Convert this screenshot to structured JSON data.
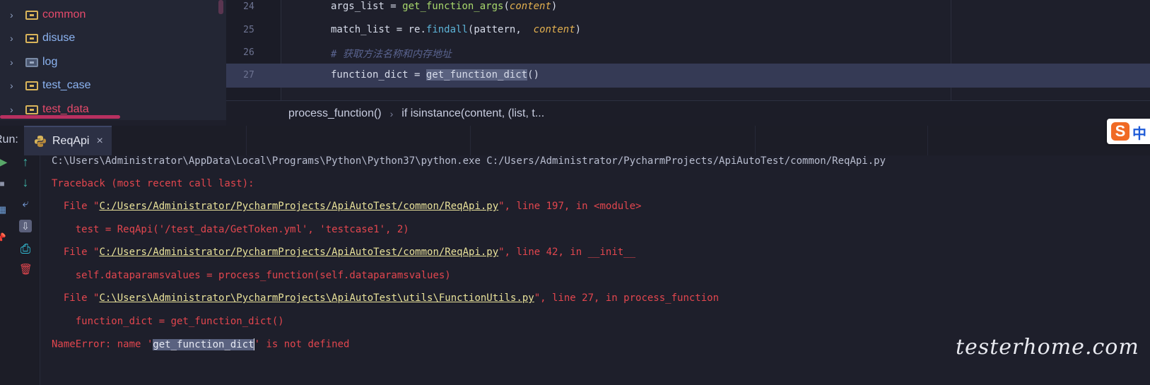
{
  "project_tree": {
    "items": [
      {
        "label": "common",
        "color": "#e64a6b",
        "folder": "folder-icon"
      },
      {
        "label": "disuse",
        "color": "#8cb4f2",
        "folder": "folder-icon"
      },
      {
        "label": "log",
        "color": "#8cb4f2",
        "folder": "log-folder-icon"
      },
      {
        "label": "test_case",
        "color": "#8cb4f2",
        "folder": "folder-icon"
      },
      {
        "label": "test_data",
        "color": "#e64a6b",
        "folder": "folder-icon"
      }
    ]
  },
  "editor": {
    "lines": [
      {
        "number": "24",
        "text_a": "args_list",
        "op": " = ",
        "fn": "get_function_args",
        "paren_open": "(",
        "param": "content",
        "paren_close": ")"
      },
      {
        "number": "25",
        "text_a": "match_list",
        "op": " = ",
        "mod": "re.",
        "fn": "findall",
        "paren_open": "(",
        "arg1": "pattern,  ",
        "param": "content",
        "paren_close": ")"
      },
      {
        "number": "26",
        "comment": "# 获取方法名称和内存地址"
      },
      {
        "number": "27",
        "text_a": "function_dict",
        "op": " = ",
        "fn_sel": "get_function_dict",
        "call": "()"
      }
    ]
  },
  "breadcrumb": {
    "item1": "process_function()",
    "separator": "›",
    "item2": "if isinstance(content, (list, t..."
  },
  "run_window": {
    "title": "Run:",
    "tab_label": "ReqApi",
    "tab_icon": "python-icon",
    "close_glyph": "×"
  },
  "ime": {
    "logo": "S",
    "lang": "中"
  },
  "toolbar": {
    "rerun": "▶",
    "stop": "■",
    "layout": "▦",
    "pin": "📌",
    "up": "↑",
    "down": "↓",
    "wrap": "⤶",
    "scroll_end": "⇩",
    "print": "⎙",
    "trash": "🗑"
  },
  "console": {
    "command": "C:\\Users\\Administrator\\AppData\\Local\\Programs\\Python\\Python37\\python.exe C:/Users/Administrator/PycharmProjects/ApiAutoTest/common/ReqApi.py",
    "traceback_header": "Traceback (most recent call last):",
    "frames": [
      {
        "prefix": "  File \"",
        "path": "C:/Users/Administrator/PycharmProjects/ApiAutoTest/common/ReqApi.py",
        "suffix": "\", line 197, in <module>",
        "code": "    test = ReqApi('/test_data/GetToken.yml', 'testcase1', 2)"
      },
      {
        "prefix": "  File \"",
        "path": "C:/Users/Administrator/PycharmProjects/ApiAutoTest/common/ReqApi.py",
        "suffix": "\", line 42, in __init__",
        "code": "    self.dataparamsvalues = process_function(self.dataparamsvalues)"
      },
      {
        "prefix": "  File \"",
        "path": "C:\\Users\\Administrator\\PycharmProjects\\ApiAutoTest\\utils\\FunctionUtils.py",
        "suffix": "\", line 27, in process_function",
        "code": "    function_dict = get_function_dict()"
      }
    ],
    "error_prefix": "NameError: name '",
    "error_name": "get_function_dict",
    "error_suffix": "' is not defined"
  },
  "watermark": "testerhome.com"
}
